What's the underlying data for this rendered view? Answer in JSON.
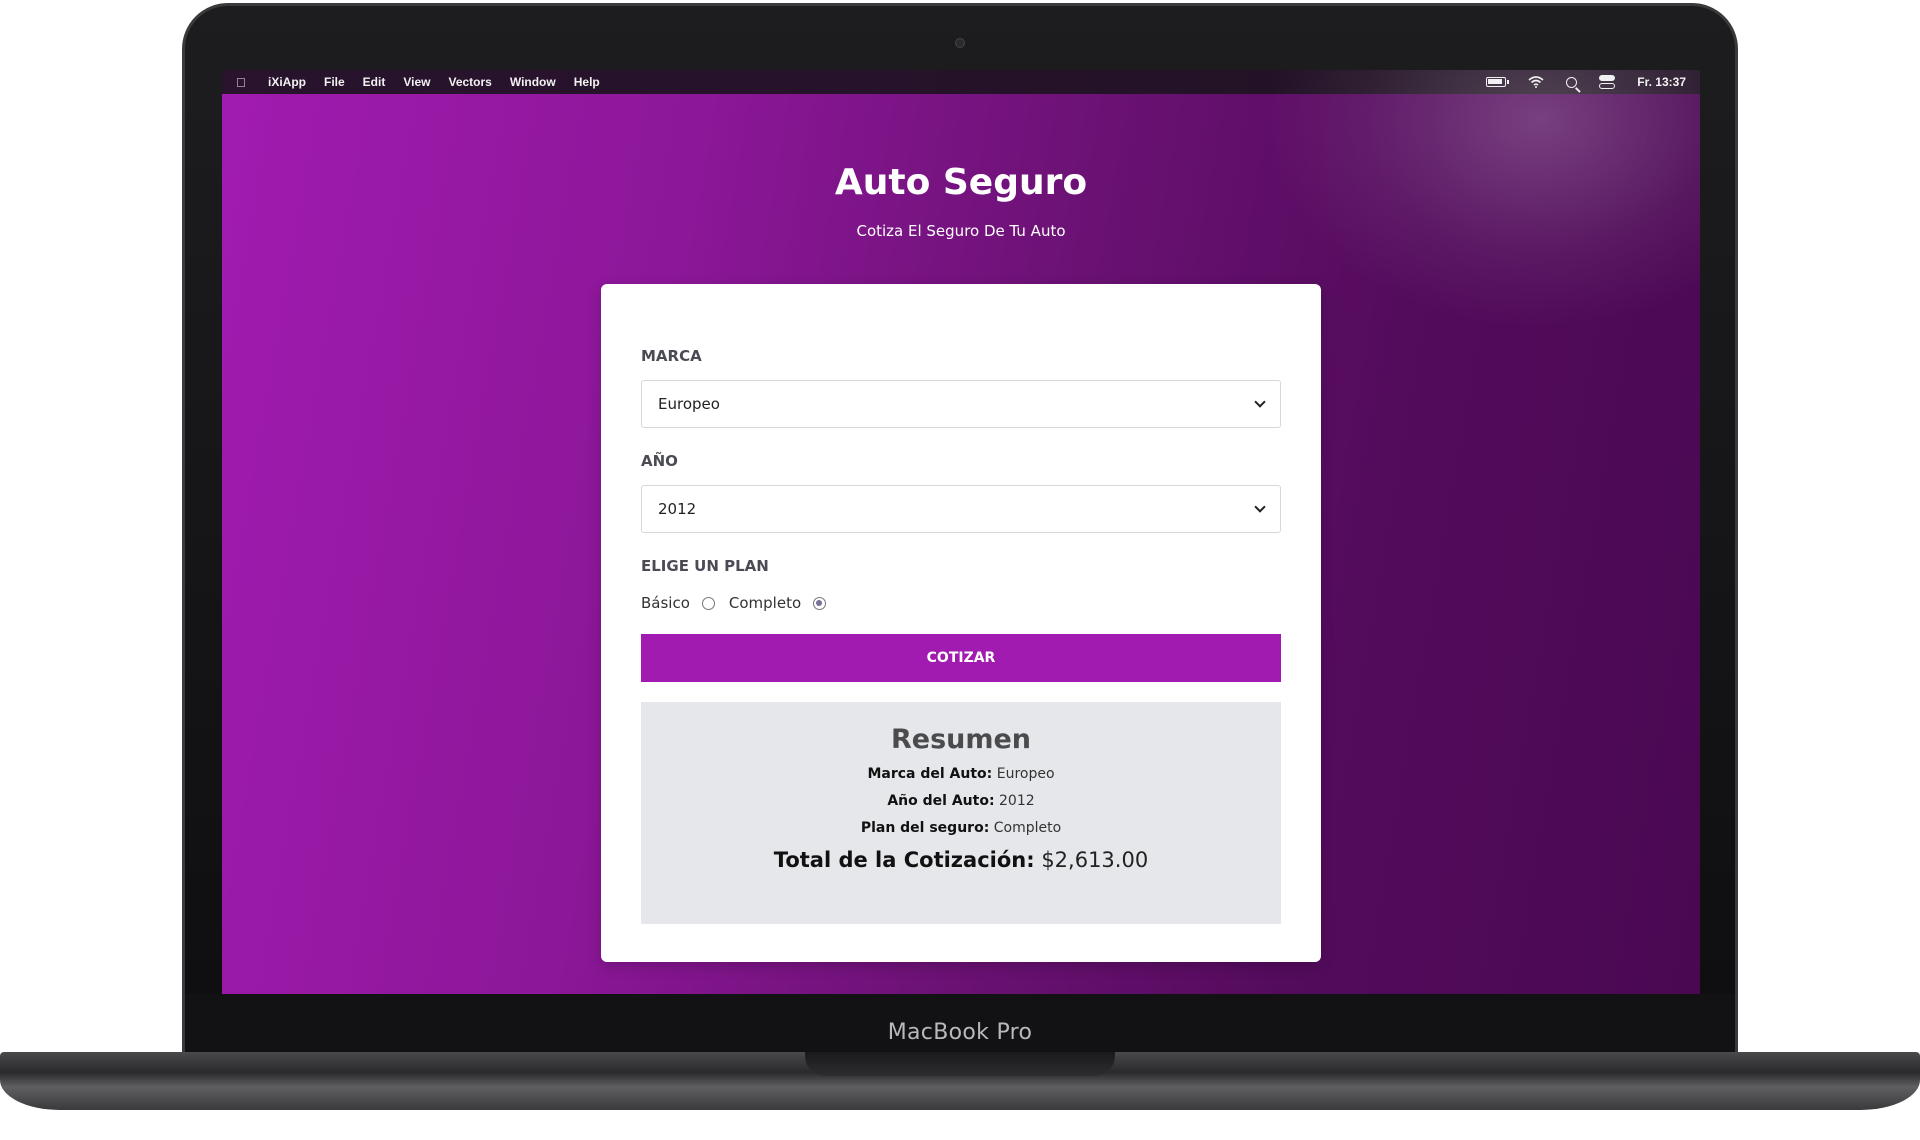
{
  "menubar": {
    "app_name": "iXiApp",
    "menus": [
      "File",
      "Edit",
      "View",
      "Vectors",
      "Window",
      "Help"
    ],
    "clock": "Fr. 13:37",
    "status_icons": [
      "battery-icon",
      "wifi-icon",
      "search-icon",
      "control-center-icon"
    ]
  },
  "header": {
    "title": "Auto Seguro",
    "subtitle": "Cotiza El Seguro De Tu Auto"
  },
  "form": {
    "marca_label": "MARCA",
    "marca_value": "Europeo",
    "anio_label": "AÑO",
    "anio_value": "2012",
    "plan_label": "ELIGE UN PLAN",
    "plan_options": [
      "Básico",
      "Completo"
    ],
    "plan_selected": "Completo",
    "submit_label": "COTIZAR"
  },
  "resumen": {
    "title": "Resumen",
    "marca_key": "Marca del Auto:",
    "marca_val": "Europeo",
    "anio_key": "Año del Auto:",
    "anio_val": "2012",
    "plan_key": "Plan del seguro:",
    "plan_val": "Completo",
    "total_key": "Total de la Cotización:",
    "total_val": "$2,613.00"
  },
  "device": {
    "brand": "MacBook Pro"
  },
  "colors": {
    "accent": "#a11bb0",
    "background_dark": "#4a0852",
    "summary_bg": "#e5e7eb"
  }
}
